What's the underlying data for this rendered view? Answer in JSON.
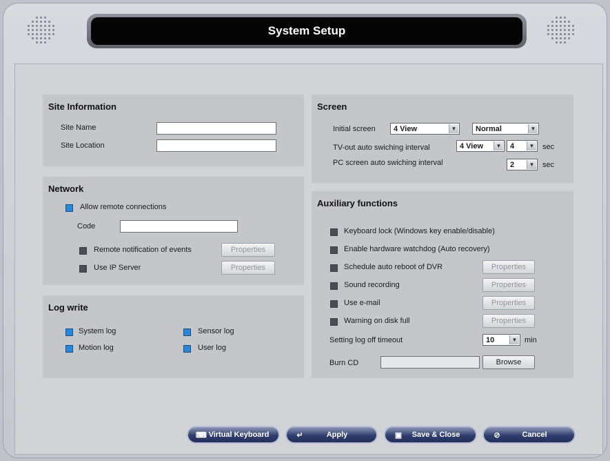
{
  "window": {
    "title": "System Setup"
  },
  "site": {
    "title": "Site Information",
    "name_label": "Site Name",
    "name_value": "",
    "location_label": "Site Location",
    "location_value": ""
  },
  "network": {
    "title": "Network",
    "allow_remote": "Allow remote connections",
    "code_label": "Code",
    "code_value": "",
    "remote_notify": "Remote notification of events",
    "use_ip_server": "Use IP Server",
    "properties": "Properties"
  },
  "log": {
    "title": "Log write",
    "system": "System log",
    "sensor": "Sensor log",
    "motion": "Motion log",
    "user": "User log"
  },
  "screen": {
    "title": "Screen",
    "initial_label": "Initial screen",
    "initial_view": "4 View",
    "initial_mode": "Normal",
    "tvout_label": "TV-out auto swiching interval",
    "tvout_view": "4 View",
    "tvout_value": "4",
    "pc_label": "PC screen auto swiching interval",
    "pc_value": "2",
    "sec": "sec"
  },
  "aux": {
    "title": "Auxiliary functions",
    "keyboard_lock": "Keyboard lock (Windows key enable/disable)",
    "watchdog": "Enable hardware watchdog (Auto recovery)",
    "auto_reboot": "Schedule auto reboot of DVR",
    "sound_recording": "Sound recording",
    "email": "Use e-mail",
    "disk_full": "Warning on disk full",
    "properties": "Properties",
    "logoff_label": "Setting log off timeout",
    "logoff_value": "10",
    "min": "min",
    "burn_label": "Burn CD",
    "burn_value": "",
    "browse": "Browse"
  },
  "actions": {
    "virtual_keyboard": "Virtual Keyboard",
    "apply": "Apply",
    "save_close": "Save & Close",
    "cancel": "Cancel"
  }
}
